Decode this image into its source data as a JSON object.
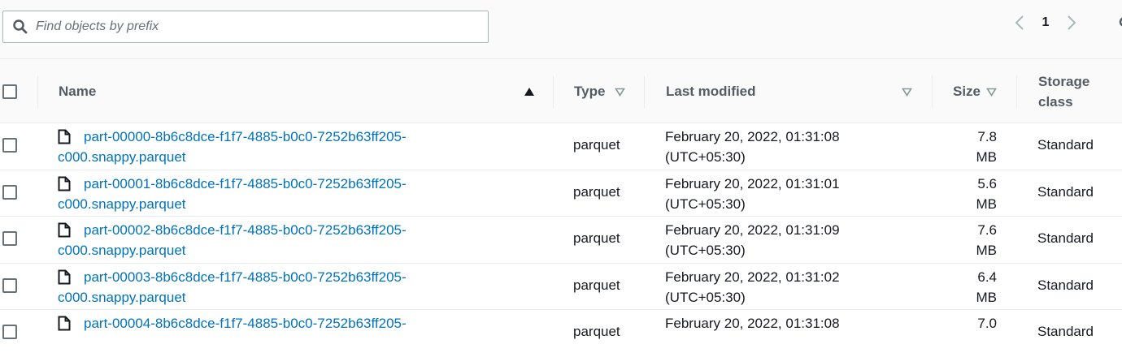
{
  "search": {
    "placeholder": "Find objects by prefix",
    "value": ""
  },
  "pagination": {
    "current_page": "1"
  },
  "table": {
    "columns": {
      "name": "Name",
      "type": "Type",
      "last_modified": "Last modified",
      "size": "Size",
      "storage_class_line1": "Storage",
      "storage_class_line2": "class"
    },
    "rows": [
      {
        "name_line1": "part-00000-8b6c8dce-f1f7-4885-b0c0-7252b63ff205-",
        "name_line2": "c000.snappy.parquet",
        "type": "parquet",
        "modified_line1": "February 20, 2022, 01:31:08",
        "modified_line2": "(UTC+05:30)",
        "size_value": "7.8",
        "size_unit": "MB",
        "storage_class": "Standard"
      },
      {
        "name_line1": "part-00001-8b6c8dce-f1f7-4885-b0c0-7252b63ff205-",
        "name_line2": "c000.snappy.parquet",
        "type": "parquet",
        "modified_line1": "February 20, 2022, 01:31:01",
        "modified_line2": "(UTC+05:30)",
        "size_value": "5.6",
        "size_unit": "MB",
        "storage_class": "Standard"
      },
      {
        "name_line1": "part-00002-8b6c8dce-f1f7-4885-b0c0-7252b63ff205-",
        "name_line2": "c000.snappy.parquet",
        "type": "parquet",
        "modified_line1": "February 20, 2022, 01:31:09",
        "modified_line2": "(UTC+05:30)",
        "size_value": "7.6",
        "size_unit": "MB",
        "storage_class": "Standard"
      },
      {
        "name_line1": "part-00003-8b6c8dce-f1f7-4885-b0c0-7252b63ff205-",
        "name_line2": "c000.snappy.parquet",
        "type": "parquet",
        "modified_line1": "February 20, 2022, 01:31:02",
        "modified_line2": "(UTC+05:30)",
        "size_value": "6.4",
        "size_unit": "MB",
        "storage_class": "Standard"
      },
      {
        "name_line1": "part-00004-8b6c8dce-f1f7-4885-b0c0-7252b63ff205-",
        "name_line2": "",
        "type": "parquet",
        "modified_line1": "February 20, 2022, 01:31:08",
        "modified_line2": "",
        "size_value": "7.0",
        "size_unit": "",
        "storage_class": "Standard"
      }
    ]
  },
  "colors": {
    "link": "#0073bb",
    "header_bg": "#fafafa",
    "border": "#eaeded",
    "muted_text": "#545b64"
  },
  "icons": [
    "search-icon",
    "chevron-left-icon",
    "chevron-right-icon",
    "sort-ascending-icon",
    "sort-descending-icon",
    "file-icon"
  ]
}
